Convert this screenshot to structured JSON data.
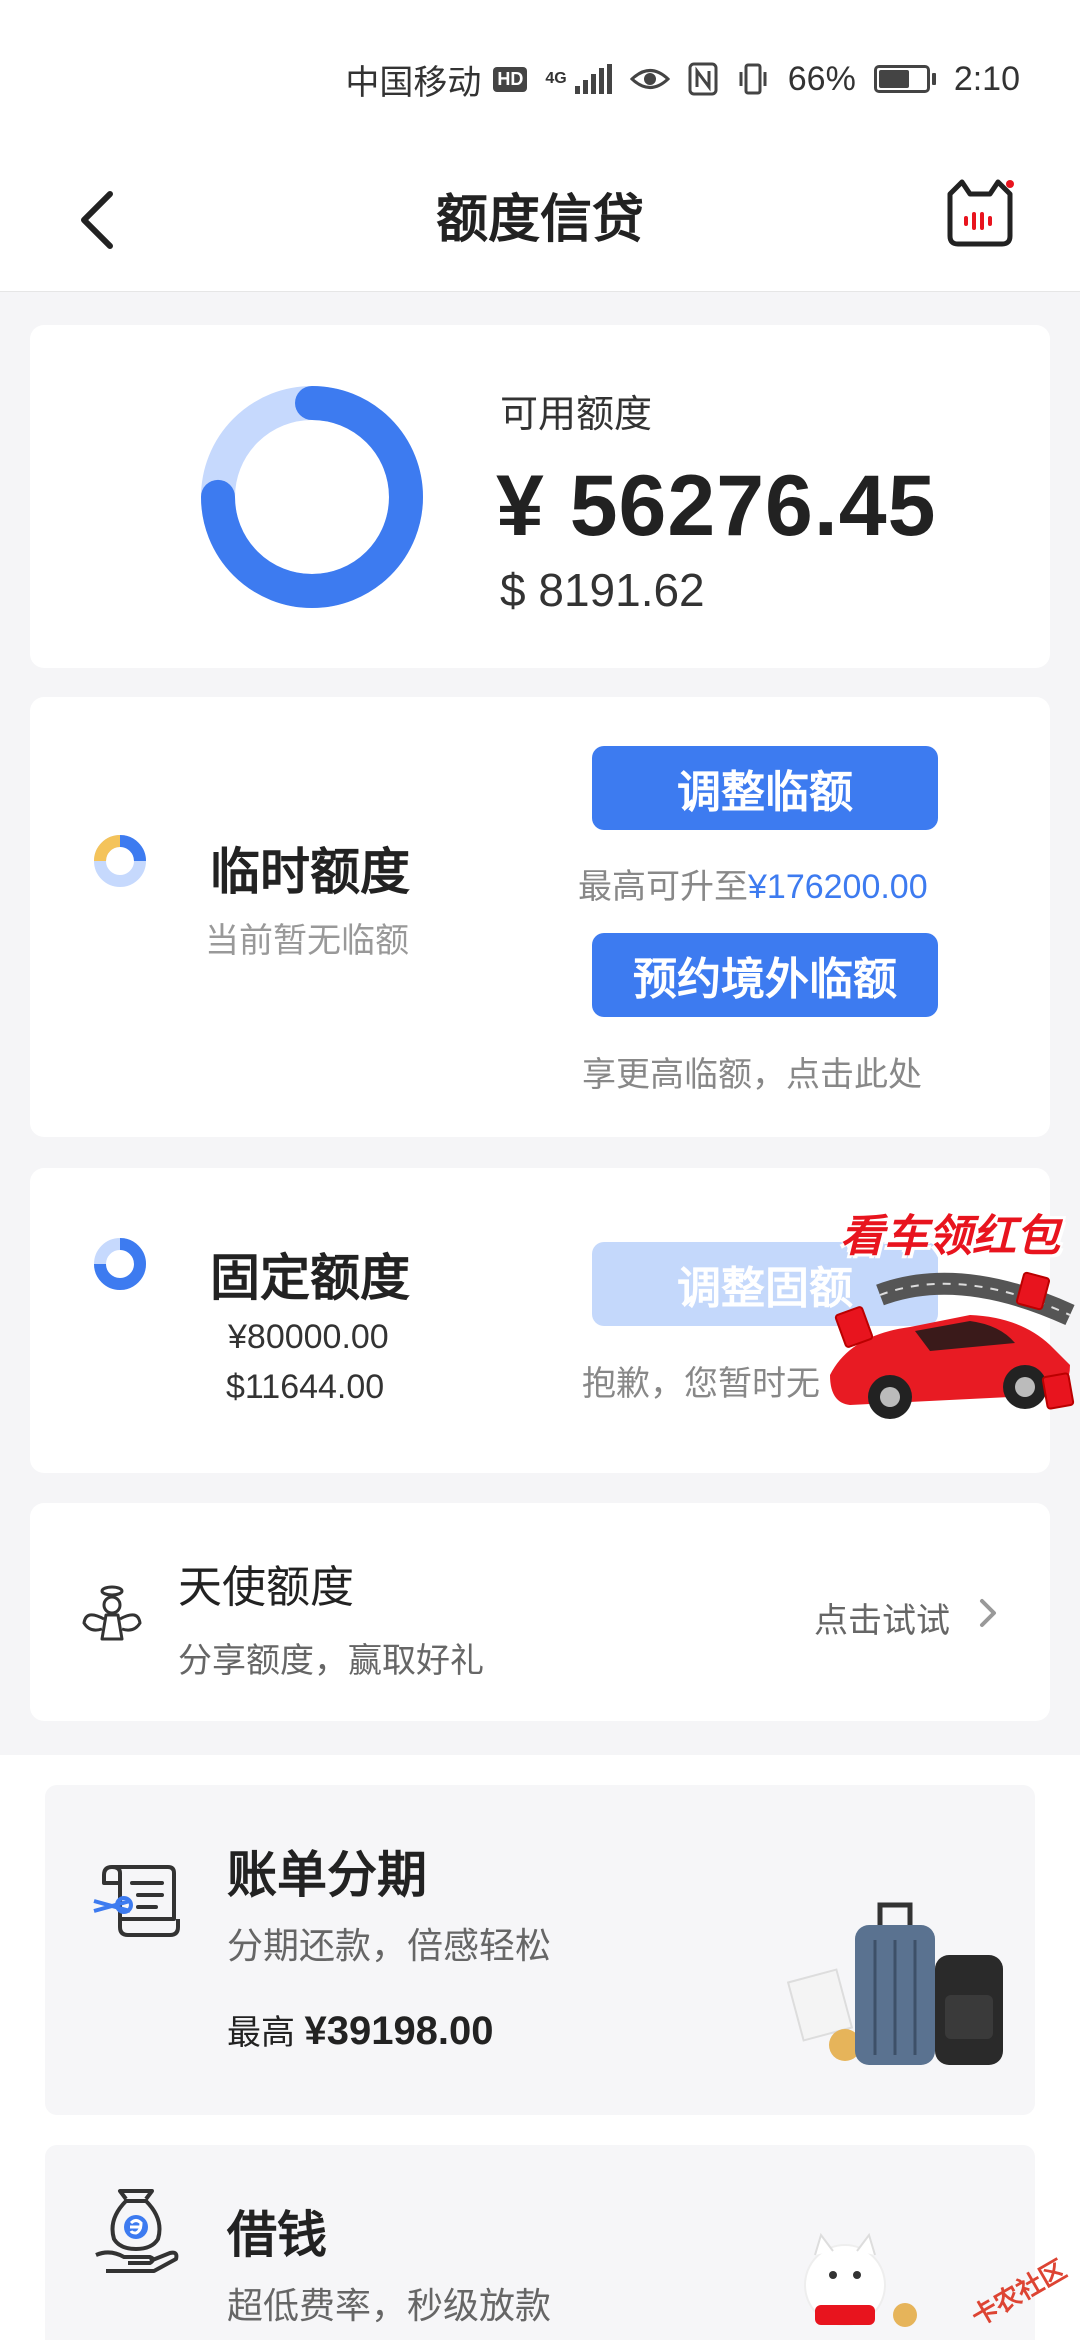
{
  "status_bar": {
    "carrier": "中国移动",
    "hd": "HD",
    "network": "4G",
    "battery_percent": "66%",
    "battery_level": 0.66,
    "time": "2:10"
  },
  "header": {
    "title": "额度信贷",
    "back_icon": "back-arrow-icon",
    "service_icon": "cat-service-icon"
  },
  "available": {
    "label": "可用额度",
    "cny": "¥ 56276.45",
    "usd": "$ 8191.62",
    "ring_used_fraction": 0.25
  },
  "temp_limit": {
    "title": "临时额度",
    "subtitle": "当前暂无临额",
    "adjust_button": "调整临额",
    "adjust_note_prefix": "最高可升至",
    "adjust_note_amount": "¥176200.00",
    "overseas_button": "预约境外临额",
    "overseas_note": "享更高临额，点击此处"
  },
  "fixed_limit": {
    "title": "固定额度",
    "cny": "¥80000.00",
    "usd": "$11644.00",
    "adjust_button": "调整固额",
    "adjust_note": "抱歉，您暂时无"
  },
  "angel": {
    "title": "天使额度",
    "subtitle": "分享额度，赢取好礼",
    "cta": "点击试试"
  },
  "installment": {
    "title": "账单分期",
    "subtitle": "分期还款，倍感轻松",
    "max_prefix": "最高",
    "max_amount": "¥39198.00"
  },
  "loan": {
    "title": "借钱",
    "subtitle": "超低费率，秒级放款"
  },
  "promo": {
    "text": "看车领红包",
    "watermark": "卡农社区"
  },
  "colors": {
    "accent": "#3d7bf0",
    "accent_light": "#c4d8fb",
    "temp_ring_yellow": "#f4c35a",
    "promo_red": "#e8141e"
  }
}
